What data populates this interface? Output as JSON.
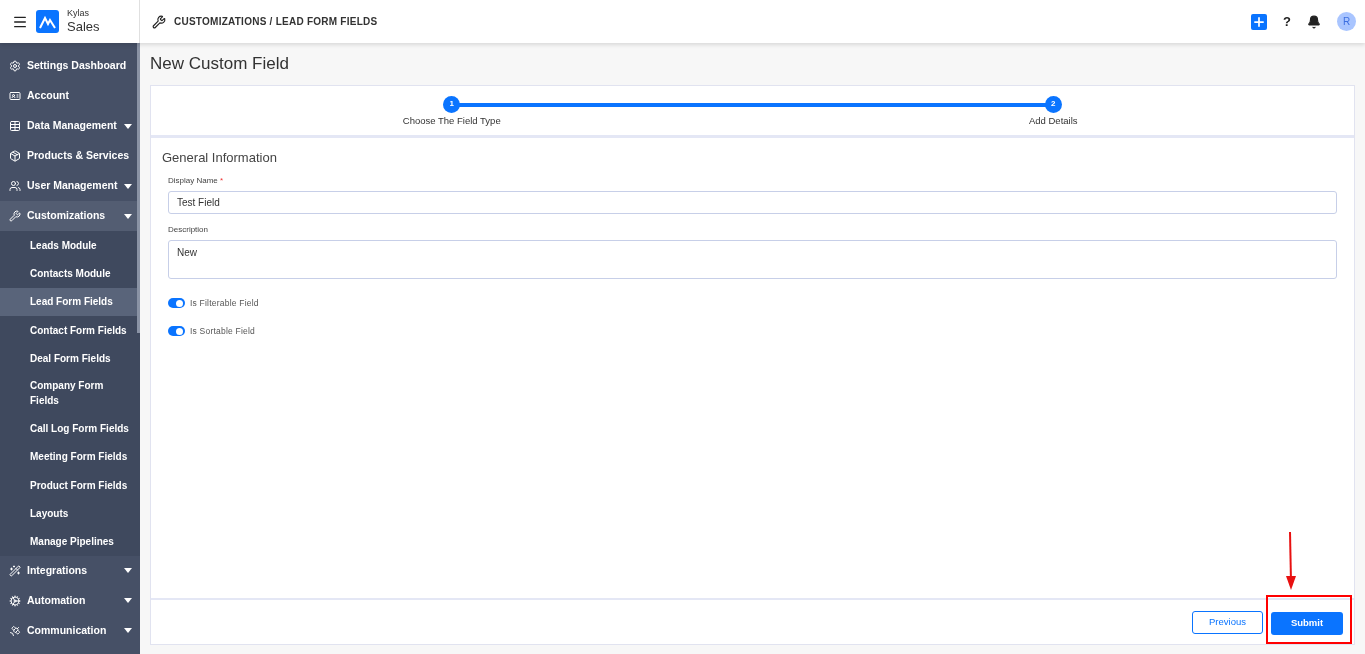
{
  "app": {
    "brand_top": "Kylas",
    "brand_bottom": "Sales"
  },
  "breadcrumb": "CUSTOMIZATIONS / LEAD FORM FIELDS",
  "header_actions": {
    "help": "?",
    "avatar": "R"
  },
  "sidebar": {
    "items": [
      {
        "label": "Settings Dashboard",
        "selected": false
      },
      {
        "label": "Account",
        "selected": false
      },
      {
        "label": "Data Management",
        "expandable": true,
        "selected": false
      },
      {
        "label": "Products & Services",
        "selected": false
      },
      {
        "label": "User Management",
        "expandable": true,
        "selected": false
      },
      {
        "label": "Customizations",
        "expandable": true,
        "selected": true,
        "children": [
          {
            "label": "Leads Module",
            "selected": false
          },
          {
            "label": "Contacts Module",
            "selected": false
          },
          {
            "label": "Lead Form Fields",
            "selected": true
          },
          {
            "label": "Contact Form Fields",
            "selected": false
          },
          {
            "label": "Deal Form Fields",
            "selected": false
          },
          {
            "label": "Company Form Fields",
            "selected": false
          },
          {
            "label": "Call Log Form Fields",
            "selected": false
          },
          {
            "label": "Meeting Form Fields",
            "selected": false
          },
          {
            "label": "Product Form Fields",
            "selected": false
          },
          {
            "label": "Layouts",
            "selected": false
          },
          {
            "label": "Manage Pipelines",
            "selected": false
          }
        ]
      },
      {
        "label": "Integrations",
        "expandable": true,
        "selected": false
      },
      {
        "label": "Automation",
        "expandable": true,
        "selected": false
      },
      {
        "label": "Communication",
        "expandable": true,
        "selected": false
      }
    ]
  },
  "page_title": "New Custom Field",
  "steps": [
    {
      "number": "1",
      "label": "Choose The Field Type"
    },
    {
      "number": "2",
      "label": "Add Details"
    }
  ],
  "section_title": "General Information",
  "fields": [
    {
      "label": "Display Name",
      "required_mark": "*",
      "value": "Test Field",
      "kind": "text"
    },
    {
      "label": "Description",
      "value": "New",
      "kind": "textarea"
    }
  ],
  "toggles": [
    {
      "label": "Is Filterable Field",
      "on": true
    },
    {
      "label": "Is Sortable Field",
      "on": true
    }
  ],
  "footer": {
    "previous": "Previous",
    "submit": "Submit",
    "submit_highlighted": true
  }
}
